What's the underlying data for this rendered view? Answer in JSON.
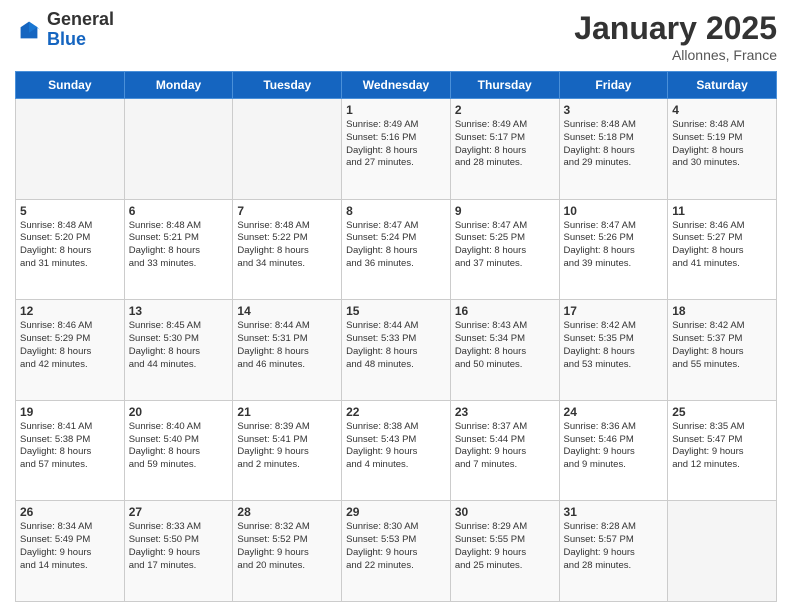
{
  "header": {
    "logo": {
      "general": "General",
      "blue": "Blue"
    },
    "title": "January 2025",
    "location": "Allonnes, France"
  },
  "calendar": {
    "days_of_week": [
      "Sunday",
      "Monday",
      "Tuesday",
      "Wednesday",
      "Thursday",
      "Friday",
      "Saturday"
    ],
    "weeks": [
      [
        {
          "day": "",
          "info": ""
        },
        {
          "day": "",
          "info": ""
        },
        {
          "day": "",
          "info": ""
        },
        {
          "day": "1",
          "info": "Sunrise: 8:49 AM\nSunset: 5:16 PM\nDaylight: 8 hours\nand 27 minutes."
        },
        {
          "day": "2",
          "info": "Sunrise: 8:49 AM\nSunset: 5:17 PM\nDaylight: 8 hours\nand 28 minutes."
        },
        {
          "day": "3",
          "info": "Sunrise: 8:48 AM\nSunset: 5:18 PM\nDaylight: 8 hours\nand 29 minutes."
        },
        {
          "day": "4",
          "info": "Sunrise: 8:48 AM\nSunset: 5:19 PM\nDaylight: 8 hours\nand 30 minutes."
        }
      ],
      [
        {
          "day": "5",
          "info": "Sunrise: 8:48 AM\nSunset: 5:20 PM\nDaylight: 8 hours\nand 31 minutes."
        },
        {
          "day": "6",
          "info": "Sunrise: 8:48 AM\nSunset: 5:21 PM\nDaylight: 8 hours\nand 33 minutes."
        },
        {
          "day": "7",
          "info": "Sunrise: 8:48 AM\nSunset: 5:22 PM\nDaylight: 8 hours\nand 34 minutes."
        },
        {
          "day": "8",
          "info": "Sunrise: 8:47 AM\nSunset: 5:24 PM\nDaylight: 8 hours\nand 36 minutes."
        },
        {
          "day": "9",
          "info": "Sunrise: 8:47 AM\nSunset: 5:25 PM\nDaylight: 8 hours\nand 37 minutes."
        },
        {
          "day": "10",
          "info": "Sunrise: 8:47 AM\nSunset: 5:26 PM\nDaylight: 8 hours\nand 39 minutes."
        },
        {
          "day": "11",
          "info": "Sunrise: 8:46 AM\nSunset: 5:27 PM\nDaylight: 8 hours\nand 41 minutes."
        }
      ],
      [
        {
          "day": "12",
          "info": "Sunrise: 8:46 AM\nSunset: 5:29 PM\nDaylight: 8 hours\nand 42 minutes."
        },
        {
          "day": "13",
          "info": "Sunrise: 8:45 AM\nSunset: 5:30 PM\nDaylight: 8 hours\nand 44 minutes."
        },
        {
          "day": "14",
          "info": "Sunrise: 8:44 AM\nSunset: 5:31 PM\nDaylight: 8 hours\nand 46 minutes."
        },
        {
          "day": "15",
          "info": "Sunrise: 8:44 AM\nSunset: 5:33 PM\nDaylight: 8 hours\nand 48 minutes."
        },
        {
          "day": "16",
          "info": "Sunrise: 8:43 AM\nSunset: 5:34 PM\nDaylight: 8 hours\nand 50 minutes."
        },
        {
          "day": "17",
          "info": "Sunrise: 8:42 AM\nSunset: 5:35 PM\nDaylight: 8 hours\nand 53 minutes."
        },
        {
          "day": "18",
          "info": "Sunrise: 8:42 AM\nSunset: 5:37 PM\nDaylight: 8 hours\nand 55 minutes."
        }
      ],
      [
        {
          "day": "19",
          "info": "Sunrise: 8:41 AM\nSunset: 5:38 PM\nDaylight: 8 hours\nand 57 minutes."
        },
        {
          "day": "20",
          "info": "Sunrise: 8:40 AM\nSunset: 5:40 PM\nDaylight: 8 hours\nand 59 minutes."
        },
        {
          "day": "21",
          "info": "Sunrise: 8:39 AM\nSunset: 5:41 PM\nDaylight: 9 hours\nand 2 minutes."
        },
        {
          "day": "22",
          "info": "Sunrise: 8:38 AM\nSunset: 5:43 PM\nDaylight: 9 hours\nand 4 minutes."
        },
        {
          "day": "23",
          "info": "Sunrise: 8:37 AM\nSunset: 5:44 PM\nDaylight: 9 hours\nand 7 minutes."
        },
        {
          "day": "24",
          "info": "Sunrise: 8:36 AM\nSunset: 5:46 PM\nDaylight: 9 hours\nand 9 minutes."
        },
        {
          "day": "25",
          "info": "Sunrise: 8:35 AM\nSunset: 5:47 PM\nDaylight: 9 hours\nand 12 minutes."
        }
      ],
      [
        {
          "day": "26",
          "info": "Sunrise: 8:34 AM\nSunset: 5:49 PM\nDaylight: 9 hours\nand 14 minutes."
        },
        {
          "day": "27",
          "info": "Sunrise: 8:33 AM\nSunset: 5:50 PM\nDaylight: 9 hours\nand 17 minutes."
        },
        {
          "day": "28",
          "info": "Sunrise: 8:32 AM\nSunset: 5:52 PM\nDaylight: 9 hours\nand 20 minutes."
        },
        {
          "day": "29",
          "info": "Sunrise: 8:30 AM\nSunset: 5:53 PM\nDaylight: 9 hours\nand 22 minutes."
        },
        {
          "day": "30",
          "info": "Sunrise: 8:29 AM\nSunset: 5:55 PM\nDaylight: 9 hours\nand 25 minutes."
        },
        {
          "day": "31",
          "info": "Sunrise: 8:28 AM\nSunset: 5:57 PM\nDaylight: 9 hours\nand 28 minutes."
        },
        {
          "day": "",
          "info": ""
        }
      ]
    ]
  }
}
